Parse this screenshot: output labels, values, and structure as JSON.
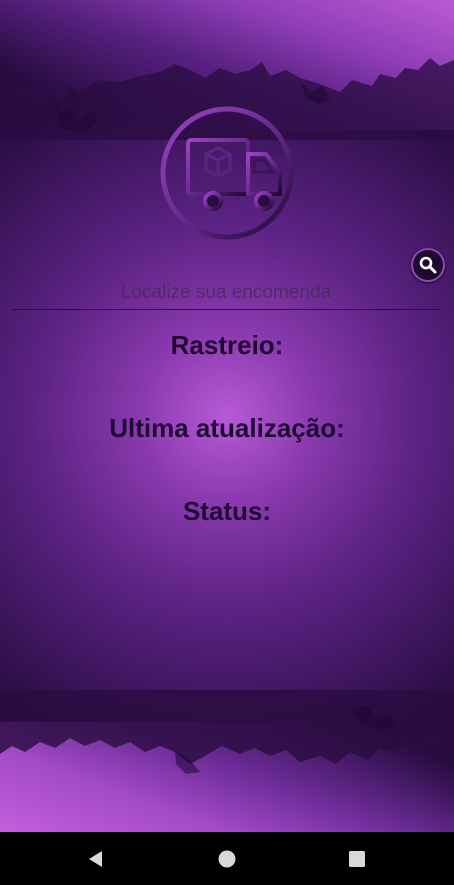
{
  "search": {
    "placeholder": "Localize sua encomenda",
    "button_icon": "search-icon"
  },
  "logo": {
    "icon": "delivery-truck-icon"
  },
  "tracking": {
    "rastreio_label": "Rastreio:",
    "ultima_label": "Ultima atualização:",
    "status_label": "Status:"
  },
  "navbar": {
    "back_icon": "back-triangle-icon",
    "home_icon": "home-circle-icon",
    "recents_icon": "recents-square-icon"
  },
  "colors": {
    "background_dark": "#1e0833",
    "background_light": "#b75ad6",
    "text_dark": "#1f0833",
    "navbar": "#000000"
  }
}
